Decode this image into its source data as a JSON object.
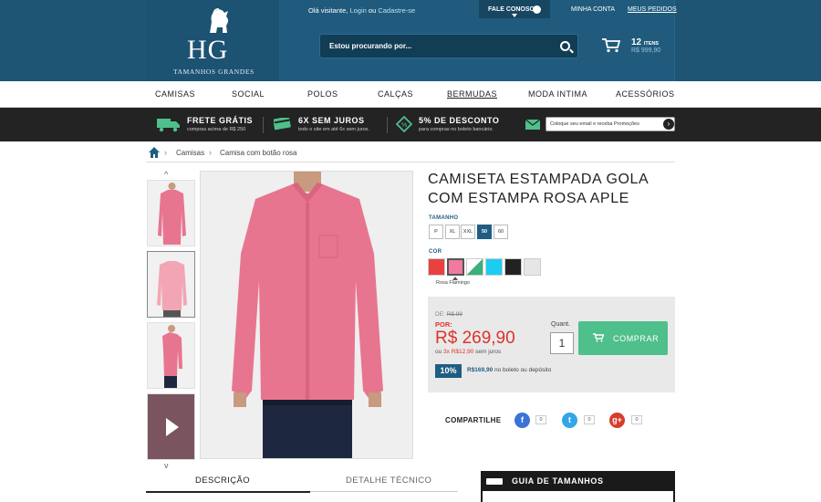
{
  "header": {
    "logo_text": "HG",
    "logo_subtitle": "TAMANHOS GRANDES",
    "welcome_prefix": "Olá visitante,",
    "login_label": "Login",
    "or_label": "ou",
    "register_label": "Cadastre-se",
    "contact_label": "FALE CONOSCO",
    "account_label": "MINHA CONTA",
    "orders_label": "MEUS PEDIDOS",
    "search_placeholder": "Estou procurando por...",
    "cart_count": "12",
    "cart_items_label": "ITENS",
    "cart_total": "R$ 999,90"
  },
  "nav": {
    "items": [
      "CAMISAS",
      "SOCIAL",
      "POLOS",
      "CALÇAS",
      "BERMUDAS",
      "MODA INTIMA",
      "ACESSÓRIOS"
    ]
  },
  "promo": {
    "items": [
      {
        "title": "FRETE GRÁTIS",
        "sub": "compras acima de R$ 250"
      },
      {
        "title": "6X SEM JUROS",
        "sub": "todo o site em até 6x sem juros."
      },
      {
        "title": "5% DE DESCONTO",
        "sub": "para compras no boleto bancário."
      }
    ],
    "newsletter_placeholder": "Coloque seu email e receba Promoções",
    "newsletter_go": "›"
  },
  "breadcrumb": {
    "items": [
      "Camisas",
      "Camisa com botão rosa"
    ]
  },
  "gallery": {
    "up_arrow": "^",
    "down_arrow": "v",
    "shirt_color": "#e8758f"
  },
  "product": {
    "title": "CAMISETA ESTAMPADA GOLA COM ESTAMPA ROSA APLE",
    "size_label": "TAMANHO",
    "sizes": [
      "P",
      "XL",
      "XXL",
      "50",
      "60"
    ],
    "selected_size": "50",
    "color_label": "COR",
    "colors": [
      "#e94040",
      "#f07aa0",
      "#3ab07a",
      "#1ccdf2",
      "#222222",
      "#e6e6e6"
    ],
    "selected_color_name": "Rosa Flamingo",
    "old_price_label": "DE:",
    "old_price": "R$ 99",
    "new_price_label": "POR:",
    "price": "R$ 269,90",
    "install_prefix": "ou",
    "install_value": "3x R$12,90",
    "install_suffix": "sem juros",
    "discount_badge": "10%",
    "discount_value": "R$169,90",
    "discount_text": "no boleto ou depósito",
    "qty_label": "Quant.",
    "qty_value": "1",
    "buy_label": "COMPRAR"
  },
  "share": {
    "label": "COMPARTILHE",
    "networks": [
      {
        "name": "facebook",
        "glyph": "f",
        "color": "#3b73d6",
        "count": "0"
      },
      {
        "name": "twitter",
        "glyph": "t",
        "color": "#33a6e8",
        "count": "0"
      },
      {
        "name": "google-plus",
        "glyph": "g+",
        "color": "#d63d2e",
        "count": "0"
      }
    ]
  },
  "tabs": {
    "description": "DESCRIÇÃO",
    "technical": "DETALHE TÉCNICO"
  },
  "size_guide": {
    "label": "GUIA DE TAMANHOS"
  }
}
